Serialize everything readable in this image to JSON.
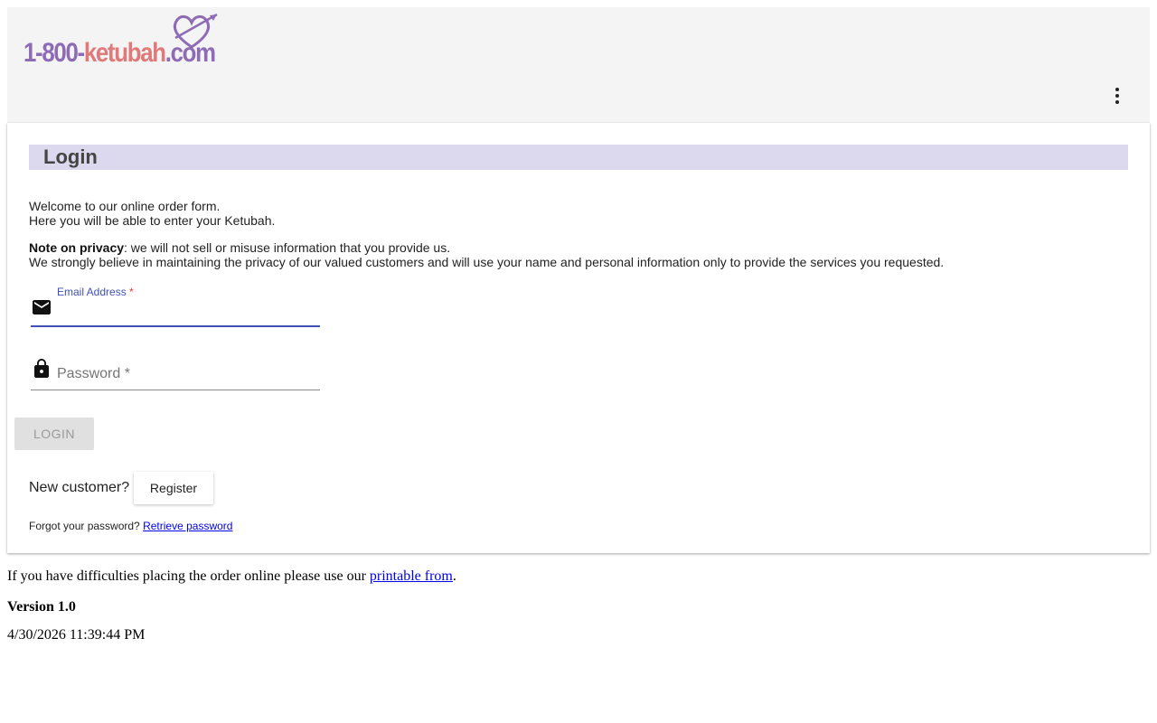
{
  "header": {
    "logo": {
      "part1": "1-800-",
      "part2": "ketubah",
      "part3": ".com",
      "colors": {
        "purple": "#8e6cb5",
        "pink": "#e07a7a"
      }
    },
    "more_icon": "more-vert-icon"
  },
  "login": {
    "title": "Login",
    "intro_line1": "Welcome to our online order form.",
    "intro_line2": "Here you will be able to enter your Ketubah.",
    "privacy_label": "Note on privacy",
    "privacy_text": ": we will not sell or misuse information that you provide us.",
    "privacy_line2": "We strongly believe in maintaining the privacy of our valued customers and will use your name and personal information only to provide the services you requested.",
    "email": {
      "label": "Email Address",
      "required_mark": "*",
      "value": "",
      "icon": "email-icon"
    },
    "password": {
      "placeholder": "Password *",
      "value": "",
      "icon": "lock-icon"
    },
    "login_button": "LOGIN",
    "new_customer_text": "New customer?",
    "register_button": "Register",
    "forgot_text": "Forgot your password?",
    "retrieve_link": "Retrieve password",
    "accent_color": "#3f51b5",
    "title_bar_color": "#dcd9ef"
  },
  "footer": {
    "difficulty_text": "If you have difficulties placing the order online please use our",
    "printable_link": "printable from",
    "period": ".",
    "version": "Version 1.0",
    "timestamp": "4/30/2026 11:39:44 PM"
  }
}
